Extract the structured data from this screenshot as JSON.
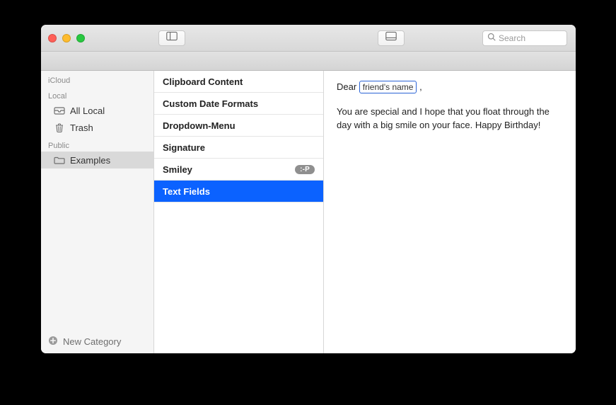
{
  "search": {
    "placeholder": "Search"
  },
  "sidebar": {
    "sections": [
      {
        "label": "iCloud",
        "items": []
      },
      {
        "label": "Local",
        "items": [
          {
            "name": "all-local",
            "label": "All Local",
            "icon": "tray-icon"
          },
          {
            "name": "trash",
            "label": "Trash",
            "icon": "trash-icon"
          }
        ]
      },
      {
        "label": "Public",
        "items": [
          {
            "name": "examples",
            "label": "Examples",
            "icon": "folder-icon",
            "selected": true
          }
        ]
      }
    ],
    "footer": {
      "label": "New Category"
    }
  },
  "list": {
    "items": [
      {
        "label": "Clipboard Content"
      },
      {
        "label": "Custom Date Formats"
      },
      {
        "label": "Dropdown-Menu"
      },
      {
        "label": "Signature"
      },
      {
        "label": "Smiley",
        "badge": ":-P"
      },
      {
        "label": "Text Fields",
        "selected": true
      }
    ]
  },
  "content": {
    "greeting_prefix": "Dear ",
    "token": "friend's name",
    "greeting_suffix": ",",
    "body": "You are special and I hope that you float through the day with a big smile on your face. Happy Birthday!"
  }
}
